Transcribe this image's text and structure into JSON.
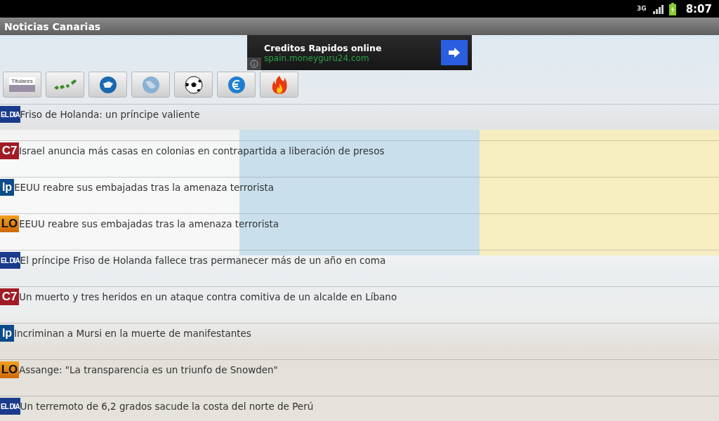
{
  "status_bar": {
    "network": "3G",
    "time": "8:07"
  },
  "window": {
    "title": "Noticias Canarias"
  },
  "ad": {
    "title": "Creditos Rapidos online",
    "url": "spain.moneyguru24.com"
  },
  "toolbar": [
    {
      "kind": "headlines",
      "label": "Titulares"
    },
    {
      "kind": "islands"
    },
    {
      "kind": "island"
    },
    {
      "kind": "globe"
    },
    {
      "kind": "football"
    },
    {
      "kind": "euro"
    },
    {
      "kind": "fire"
    }
  ],
  "news": [
    {
      "kind": "el-dia",
      "logo": "EL DIA",
      "headline": "Friso de Holanda: un príncipe valiente"
    },
    {
      "kind": "c7",
      "logo": "C7",
      "headline": "Israel anuncia más casas en colonias en contrapartida a liberación de presos"
    },
    {
      "kind": "lp",
      "logo": "lp",
      "headline": "EEUU reabre sus embajadas tras la amenaza terrorista"
    },
    {
      "kind": "lo",
      "logo": "LO",
      "headline": "EEUU reabre sus embajadas tras la amenaza terrorista"
    },
    {
      "kind": "el-dia",
      "logo": "EL DIA",
      "headline": "El príncipe Friso de Holanda fallece tras permanecer más de un año en coma"
    },
    {
      "kind": "c7",
      "logo": "C7",
      "headline": "Un muerto y tres heridos en un ataque contra comitiva de un alcalde en Líbano"
    },
    {
      "kind": "lp",
      "logo": "lp",
      "headline": "Incriminan a Mursi en la muerte de manifestantes"
    },
    {
      "kind": "lo",
      "logo": "LO",
      "headline": "Assange: \"La transparencia es un triunfo de Snowden\""
    },
    {
      "kind": "el-dia",
      "logo": "EL DIA",
      "headline": "Un terremoto de 6,2 grados sacude la costa del norte de Perú"
    }
  ]
}
